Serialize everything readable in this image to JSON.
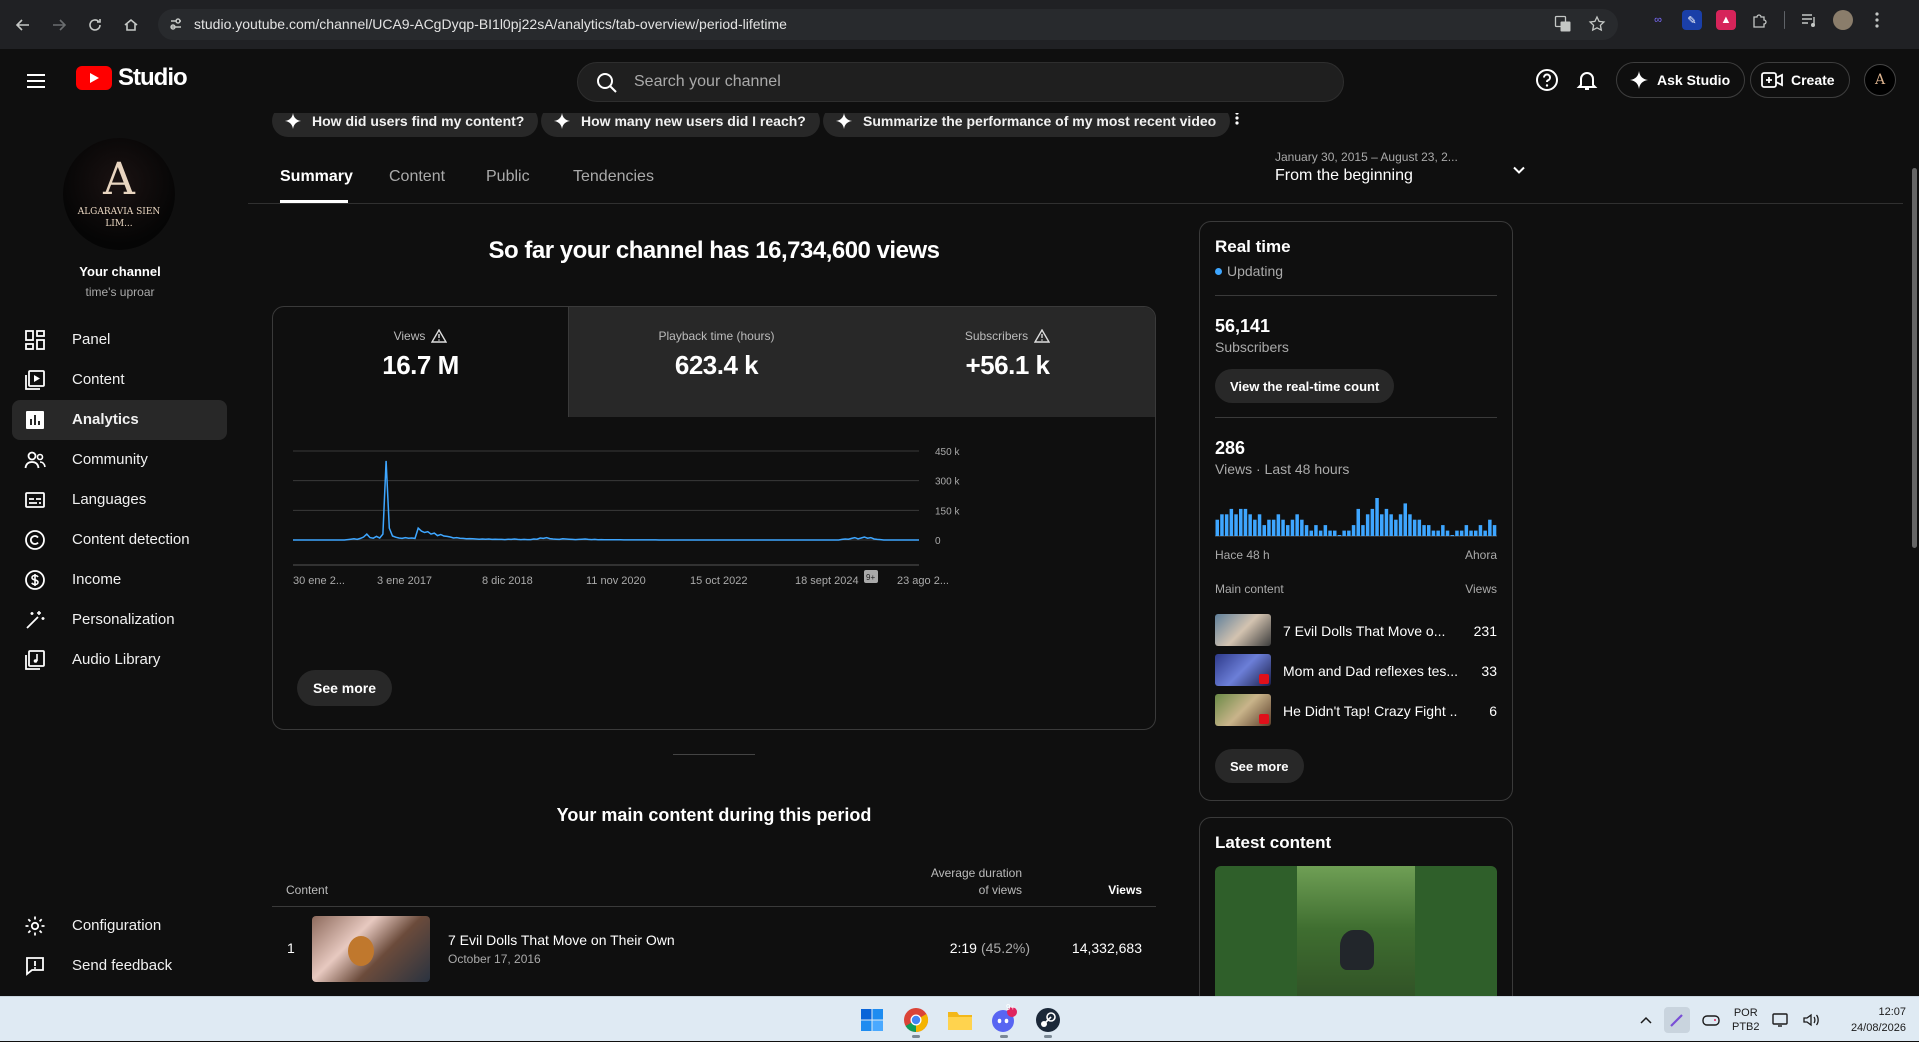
{
  "browser": {
    "url": "studio.youtube.com/channel/UCA9-ACgDyqp-BI1l0pj22sA/analytics/tab-overview/period-lifetime"
  },
  "header": {
    "brand": "Studio",
    "search_placeholder": "Search your channel",
    "ask_label": "Ask Studio",
    "create_label": "Create"
  },
  "sidebar": {
    "avatar_initial": "A",
    "avatar_name": "ALGARAVIA SIEN LIM...",
    "your_channel": "Your channel",
    "handle": "time's uproar",
    "items": [
      {
        "label": "Panel",
        "icon": "dashboard-icon"
      },
      {
        "label": "Content",
        "icon": "content-icon"
      },
      {
        "label": "Analytics",
        "icon": "analytics-icon",
        "active": true
      },
      {
        "label": "Community",
        "icon": "community-icon"
      },
      {
        "label": "Languages",
        "icon": "subtitles-icon"
      },
      {
        "label": "Content detection",
        "icon": "copyright-icon"
      },
      {
        "label": "Income",
        "icon": "dollar-icon"
      },
      {
        "label": "Personalization",
        "icon": "magic-wand-icon"
      },
      {
        "label": "Audio Library",
        "icon": "audio-library-icon"
      }
    ],
    "footer": [
      {
        "label": "Configuration",
        "icon": "gear-icon"
      },
      {
        "label": "Send feedback",
        "icon": "feedback-icon"
      }
    ]
  },
  "chips": [
    "How did users find my content?",
    "How many new users did I reach?",
    "Summarize the performance of my most recent video"
  ],
  "tabs": [
    "Summary",
    "Content",
    "Public",
    "Tendencies"
  ],
  "date_range": {
    "dates": "January 30, 2015 – August 23, 2...",
    "preset": "From the beginning"
  },
  "headline": "So far your channel has 16,734,600 views",
  "metrics": [
    {
      "label": "Views",
      "value": "16.7 M",
      "warning": true
    },
    {
      "label": "Playback time (hours)",
      "value": "623.4 k",
      "warning": false
    },
    {
      "label": "Subscribers",
      "value": "+56.1 k",
      "warning": true
    }
  ],
  "chart_data": {
    "type": "line",
    "series": [
      {
        "values": [
          0,
          0,
          0,
          0,
          0,
          0,
          0,
          0,
          0,
          0,
          0,
          0,
          0,
          0,
          0,
          0,
          0,
          2000,
          4000,
          6000,
          3000,
          8000,
          15000,
          30000,
          12000,
          9000,
          18000,
          10000,
          30000,
          400000,
          60000,
          20000,
          14000,
          10000,
          8000,
          12000,
          9000,
          10000,
          8000,
          60000,
          45000,
          38000,
          42000,
          30000,
          35000,
          22000,
          28000,
          20000,
          18000,
          15000,
          10000,
          12000,
          9000,
          8000,
          6000,
          7000,
          6000,
          5000,
          4000,
          5000,
          4000,
          5000,
          3000,
          4000,
          3000,
          3000,
          2000,
          4000,
          3000,
          5000,
          3000,
          2000,
          3000,
          2000,
          2000,
          5000,
          4000,
          10000,
          8000,
          12000,
          7000,
          5000,
          4000,
          3000,
          6000,
          5000,
          4000,
          3000,
          2000,
          3000,
          4000,
          5000,
          3000,
          2000,
          3000,
          1500,
          2000,
          1500,
          1000,
          1000,
          1000,
          800,
          800,
          600,
          500,
          500,
          400,
          500,
          400,
          400,
          300,
          300,
          300,
          300,
          200,
          200,
          200,
          200,
          200,
          200,
          200,
          200,
          200,
          200,
          200,
          200,
          200,
          200,
          200,
          200,
          200,
          200,
          200,
          200,
          200,
          200,
          200,
          200,
          200,
          200,
          200,
          200,
          200,
          200,
          200,
          200,
          200,
          200,
          200,
          200,
          200,
          200,
          200,
          200,
          200,
          200,
          200,
          200,
          200,
          200,
          200,
          200,
          200,
          200,
          200,
          200,
          200,
          200,
          200,
          200,
          200,
          3000,
          5000,
          4000,
          8000,
          12000,
          6000,
          10000,
          15000,
          9000,
          12000,
          5000,
          3000,
          2000,
          0,
          0,
          0,
          0,
          0,
          0,
          0,
          0,
          0,
          0,
          0,
          0
        ]
      }
    ],
    "x_tick_labels": [
      "30 ene 2...",
      "3 ene 2017",
      "8 dic 2018",
      "11 nov 2020",
      "15 oct 2022",
      "18 sept 2024",
      "23 ago 2..."
    ],
    "y_tick_labels": [
      "450 k",
      "300 k",
      "150 k",
      "0"
    ],
    "ylim": [
      0,
      450000
    ],
    "annotation": "9+",
    "grid": true
  },
  "see_more": "See more",
  "main_content": {
    "title": "Your main content during this period",
    "col_content": "Content",
    "col_duration_1": "Average duration",
    "col_duration_2": "of views",
    "col_views": "Views",
    "rows": [
      {
        "rank": "1",
        "title": "7 Evil Dolls That Move on Their Own",
        "date": "October 17, 2016",
        "duration": "2:19",
        "pct": "(45.2%)",
        "views": "14,332,683"
      }
    ]
  },
  "realtime": {
    "title": "Real time",
    "status": "Updating",
    "subscribers": "56,141",
    "subscribers_label": "Subscribers",
    "count_button": "View the real-time count",
    "views_48h": "286",
    "views_48h_label": "Views · Last 48 hours",
    "spark_values": [
      3,
      4,
      4,
      5,
      4,
      5,
      5,
      4,
      3,
      4,
      2,
      3,
      3,
      4,
      3,
      2,
      3,
      4,
      3,
      2,
      1,
      2,
      1,
      2,
      1,
      1,
      0,
      1,
      1,
      2,
      5,
      2,
      4,
      5,
      7,
      4,
      5,
      4,
      3,
      4,
      6,
      4,
      3,
      3,
      2,
      2,
      1,
      1,
      2,
      1,
      0,
      1,
      1,
      2,
      1,
      1,
      2,
      1,
      3,
      2
    ],
    "ago_label": "Hace 48 h",
    "now_label": "Ahora",
    "main_content_label": "Main content",
    "views_label": "Views",
    "items": [
      {
        "title": "7 Evil Dolls That Move o...",
        "views": "231"
      },
      {
        "title": "Mom and Dad reflexes tes...",
        "views": "33"
      },
      {
        "title": "He Didn't Tap! Crazy Fight ...",
        "views": "6"
      }
    ],
    "see_more": "See more"
  },
  "latest": {
    "title": "Latest content"
  },
  "taskbar": {
    "lang_1": "POR",
    "lang_2": "PTB2",
    "time": "12:07",
    "date": "24/08/2026",
    "discord_badge": "9+"
  },
  "colors": {
    "accent": "#3ea6ff",
    "youtube_red": "#ff0000",
    "background": "#0f0f0f"
  }
}
